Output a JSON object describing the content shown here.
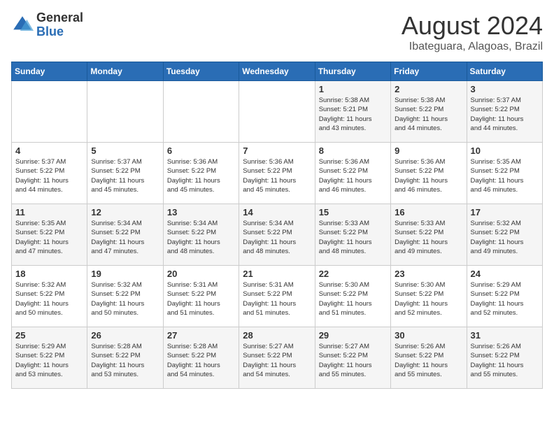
{
  "header": {
    "logo_general": "General",
    "logo_blue": "Blue",
    "month_year": "August 2024",
    "location": "Ibateguara, Alagoas, Brazil"
  },
  "days_of_week": [
    "Sunday",
    "Monday",
    "Tuesday",
    "Wednesday",
    "Thursday",
    "Friday",
    "Saturday"
  ],
  "weeks": [
    [
      {
        "day": "",
        "info": ""
      },
      {
        "day": "",
        "info": ""
      },
      {
        "day": "",
        "info": ""
      },
      {
        "day": "",
        "info": ""
      },
      {
        "day": "1",
        "info": "Sunrise: 5:38 AM\nSunset: 5:21 PM\nDaylight: 11 hours\nand 43 minutes."
      },
      {
        "day": "2",
        "info": "Sunrise: 5:38 AM\nSunset: 5:22 PM\nDaylight: 11 hours\nand 44 minutes."
      },
      {
        "day": "3",
        "info": "Sunrise: 5:37 AM\nSunset: 5:22 PM\nDaylight: 11 hours\nand 44 minutes."
      }
    ],
    [
      {
        "day": "4",
        "info": "Sunrise: 5:37 AM\nSunset: 5:22 PM\nDaylight: 11 hours\nand 44 minutes."
      },
      {
        "day": "5",
        "info": "Sunrise: 5:37 AM\nSunset: 5:22 PM\nDaylight: 11 hours\nand 45 minutes."
      },
      {
        "day": "6",
        "info": "Sunrise: 5:36 AM\nSunset: 5:22 PM\nDaylight: 11 hours\nand 45 minutes."
      },
      {
        "day": "7",
        "info": "Sunrise: 5:36 AM\nSunset: 5:22 PM\nDaylight: 11 hours\nand 45 minutes."
      },
      {
        "day": "8",
        "info": "Sunrise: 5:36 AM\nSunset: 5:22 PM\nDaylight: 11 hours\nand 46 minutes."
      },
      {
        "day": "9",
        "info": "Sunrise: 5:36 AM\nSunset: 5:22 PM\nDaylight: 11 hours\nand 46 minutes."
      },
      {
        "day": "10",
        "info": "Sunrise: 5:35 AM\nSunset: 5:22 PM\nDaylight: 11 hours\nand 46 minutes."
      }
    ],
    [
      {
        "day": "11",
        "info": "Sunrise: 5:35 AM\nSunset: 5:22 PM\nDaylight: 11 hours\nand 47 minutes."
      },
      {
        "day": "12",
        "info": "Sunrise: 5:34 AM\nSunset: 5:22 PM\nDaylight: 11 hours\nand 47 minutes."
      },
      {
        "day": "13",
        "info": "Sunrise: 5:34 AM\nSunset: 5:22 PM\nDaylight: 11 hours\nand 48 minutes."
      },
      {
        "day": "14",
        "info": "Sunrise: 5:34 AM\nSunset: 5:22 PM\nDaylight: 11 hours\nand 48 minutes."
      },
      {
        "day": "15",
        "info": "Sunrise: 5:33 AM\nSunset: 5:22 PM\nDaylight: 11 hours\nand 48 minutes."
      },
      {
        "day": "16",
        "info": "Sunrise: 5:33 AM\nSunset: 5:22 PM\nDaylight: 11 hours\nand 49 minutes."
      },
      {
        "day": "17",
        "info": "Sunrise: 5:32 AM\nSunset: 5:22 PM\nDaylight: 11 hours\nand 49 minutes."
      }
    ],
    [
      {
        "day": "18",
        "info": "Sunrise: 5:32 AM\nSunset: 5:22 PM\nDaylight: 11 hours\nand 50 minutes."
      },
      {
        "day": "19",
        "info": "Sunrise: 5:32 AM\nSunset: 5:22 PM\nDaylight: 11 hours\nand 50 minutes."
      },
      {
        "day": "20",
        "info": "Sunrise: 5:31 AM\nSunset: 5:22 PM\nDaylight: 11 hours\nand 51 minutes."
      },
      {
        "day": "21",
        "info": "Sunrise: 5:31 AM\nSunset: 5:22 PM\nDaylight: 11 hours\nand 51 minutes."
      },
      {
        "day": "22",
        "info": "Sunrise: 5:30 AM\nSunset: 5:22 PM\nDaylight: 11 hours\nand 51 minutes."
      },
      {
        "day": "23",
        "info": "Sunrise: 5:30 AM\nSunset: 5:22 PM\nDaylight: 11 hours\nand 52 minutes."
      },
      {
        "day": "24",
        "info": "Sunrise: 5:29 AM\nSunset: 5:22 PM\nDaylight: 11 hours\nand 52 minutes."
      }
    ],
    [
      {
        "day": "25",
        "info": "Sunrise: 5:29 AM\nSunset: 5:22 PM\nDaylight: 11 hours\nand 53 minutes."
      },
      {
        "day": "26",
        "info": "Sunrise: 5:28 AM\nSunset: 5:22 PM\nDaylight: 11 hours\nand 53 minutes."
      },
      {
        "day": "27",
        "info": "Sunrise: 5:28 AM\nSunset: 5:22 PM\nDaylight: 11 hours\nand 54 minutes."
      },
      {
        "day": "28",
        "info": "Sunrise: 5:27 AM\nSunset: 5:22 PM\nDaylight: 11 hours\nand 54 minutes."
      },
      {
        "day": "29",
        "info": "Sunrise: 5:27 AM\nSunset: 5:22 PM\nDaylight: 11 hours\nand 55 minutes."
      },
      {
        "day": "30",
        "info": "Sunrise: 5:26 AM\nSunset: 5:22 PM\nDaylight: 11 hours\nand 55 minutes."
      },
      {
        "day": "31",
        "info": "Sunrise: 5:26 AM\nSunset: 5:22 PM\nDaylight: 11 hours\nand 55 minutes."
      }
    ]
  ]
}
